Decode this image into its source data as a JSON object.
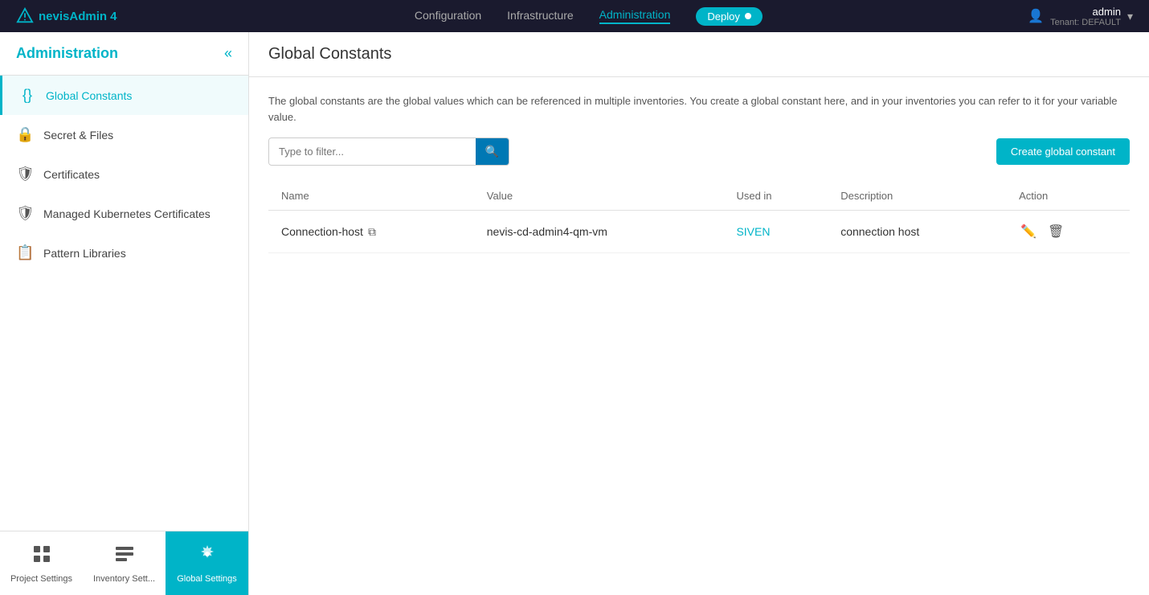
{
  "app": {
    "name": "nevisAdmin 4",
    "logo_text": "nevisAdmin 4"
  },
  "top_nav": {
    "links": [
      {
        "id": "configuration",
        "label": "Configuration",
        "active": false
      },
      {
        "id": "infrastructure",
        "label": "Infrastructure",
        "active": false
      },
      {
        "id": "administration",
        "label": "Administration",
        "active": true
      }
    ],
    "deploy_label": "Deploy",
    "user_name": "admin",
    "tenant": "Tenant: DEFAULT"
  },
  "sidebar": {
    "title": "Administration",
    "collapse_icon": "«",
    "items": [
      {
        "id": "global-constants",
        "label": "Global Constants",
        "icon": "{}"
      },
      {
        "id": "secret-files",
        "label": "Secret & Files",
        "icon": "🔒"
      },
      {
        "id": "certificates",
        "label": "Certificates",
        "icon": "🛡"
      },
      {
        "id": "managed-kubernetes",
        "label": "Managed Kubernetes Certificates",
        "icon": "🛡"
      },
      {
        "id": "pattern-libraries",
        "label": "Pattern Libraries",
        "icon": "📋"
      }
    ]
  },
  "bottom_bar": {
    "buttons": [
      {
        "id": "project-settings",
        "label": "Project Settings",
        "active": false
      },
      {
        "id": "inventory-settings",
        "label": "Inventory Sett...",
        "active": false
      },
      {
        "id": "global-settings",
        "label": "Global Settings",
        "active": true
      }
    ]
  },
  "content": {
    "page_title": "Global Constants",
    "description": "The global constants are the global values which can be referenced in multiple inventories. You create a global constant here, and in your inventories you can refer to it for your variable value.",
    "filter_placeholder": "Type to filter...",
    "create_button_label": "Create global constant",
    "table": {
      "columns": [
        "Name",
        "Value",
        "Used in",
        "Description",
        "Action"
      ],
      "rows": [
        {
          "name": "Connection-host",
          "value": "nevis-cd-admin4-qm-vm",
          "used_in": "SIVEN",
          "description": "connection host"
        }
      ]
    }
  }
}
